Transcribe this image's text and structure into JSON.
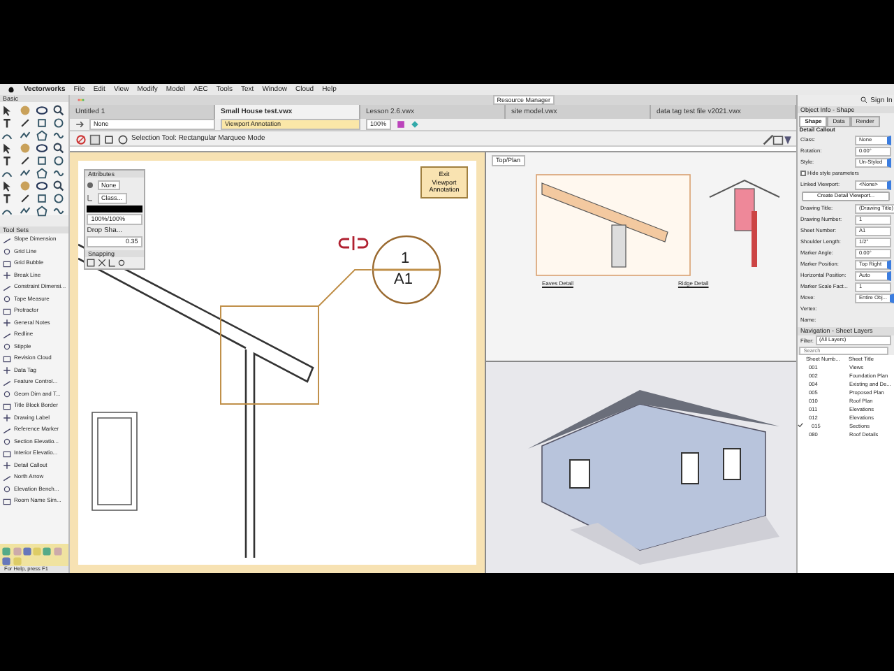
{
  "menu_bar": {
    "items": [
      "Vectorworks",
      "File",
      "Edit",
      "View",
      "Modify",
      "Model",
      "AEC",
      "Tools",
      "Text",
      "Window",
      "Cloud",
      "Help"
    ]
  },
  "title_bar": {
    "resource_manager": "Resource Manager",
    "sign_in": "Sign In"
  },
  "tabs": [
    {
      "label": "Untitled 1",
      "selected": false
    },
    {
      "label": "Small House test.vwx",
      "selected": true
    },
    {
      "label": "Lesson 2.6.vwx",
      "selected": false
    },
    {
      "label": "site model.vwx",
      "selected": false
    },
    {
      "label": "data tag test file v2021.vwx",
      "selected": false
    }
  ],
  "view_bar": {
    "class": "None",
    "layer": "Viewport Annotation",
    "zoom": "100%"
  },
  "mode_bar": {
    "hint": "Selection Tool: Rectangular Marquee Mode"
  },
  "basic_palette": {
    "title": "Basic"
  },
  "tool_sets": {
    "title": "Tool Sets",
    "items": [
      "Slope Dimension",
      "Grid Line",
      "Grid Bubble",
      "Break Line",
      "Constraint Dimensi...",
      "Tape Measure",
      "Protractor",
      "General Notes",
      "Redline",
      "Stipple",
      "Revision Cloud",
      "Data Tag",
      "Feature Control...",
      "Geom Dim and T...",
      "Title Block Border",
      "Drawing Label",
      "Reference Marker",
      "Section Elevatio...",
      "Interior Elevatio...",
      "Detail Callout",
      "North Arrow",
      "Elevation Bench...",
      "Room Name Sim..."
    ]
  },
  "attributes": {
    "title": "Attributes",
    "fill": "None",
    "pen": "Class...",
    "opacity": "100%/100%",
    "drop_shadow": "Drop Sha...",
    "line_weight": "0.35"
  },
  "snapping": {
    "title": "Snapping"
  },
  "canvas": {
    "exit_button": "Exit Viewport Annotation",
    "callout_number": "1",
    "callout_sheet": "A1"
  },
  "plan_view": {
    "tab": "Top/Plan",
    "details": [
      "Eaves Detail",
      "Ridge Detail"
    ]
  },
  "object_info": {
    "title": "Object Info - Shape",
    "tabs": [
      {
        "label": "Shape",
        "selected": true
      },
      {
        "label": "Data",
        "selected": false
      },
      {
        "label": "Render",
        "selected": false
      }
    ],
    "object_type": "Detail Callout",
    "fields": [
      {
        "kind": "select",
        "label": "Class:",
        "value": "None"
      },
      {
        "kind": "text",
        "label": "Rotation:",
        "value": "0.00°"
      },
      {
        "kind": "select",
        "label": "Style:",
        "value": "Un-Styled"
      },
      {
        "kind": "checkbox",
        "label": "Hide style parameters",
        "checked": false
      },
      {
        "kind": "select",
        "label": "Linked Viewport:",
        "value": "<None>"
      },
      {
        "kind": "button",
        "label": "Create Detail Viewport..."
      },
      {
        "kind": "text",
        "label": "Drawing Title:",
        "value": "(Drawing Title)"
      },
      {
        "kind": "text",
        "label": "Drawing Number:",
        "value": "1"
      },
      {
        "kind": "text",
        "label": "Sheet Number:",
        "value": "A1"
      },
      {
        "kind": "text",
        "label": "Shoulder Length:",
        "value": "1/2\""
      },
      {
        "kind": "text",
        "label": "Marker Angle:",
        "value": "0.00°"
      },
      {
        "kind": "select",
        "label": "Marker Position:",
        "value": "Top Right"
      },
      {
        "kind": "select",
        "label": "Horizontal Position:",
        "value": "Auto"
      },
      {
        "kind": "text",
        "label": "Marker Scale Fact...",
        "value": "1"
      },
      {
        "kind": "select",
        "label": "Move:",
        "value": "Entire Obj..."
      },
      {
        "kind": "label",
        "label": "Vertex:"
      },
      {
        "kind": "label",
        "label": "Name:"
      }
    ]
  },
  "navigation": {
    "title": "Navigation - Sheet Layers",
    "filter_label": "Filter:",
    "filter": "(All Layers)",
    "search_placeholder": "Search",
    "columns": [
      "Sheet Numb...",
      "Sheet Title"
    ],
    "rows": [
      {
        "number": "001",
        "title": "Views",
        "active": false
      },
      {
        "number": "002",
        "title": "Foundation Plan",
        "active": false
      },
      {
        "number": "004",
        "title": "Existing and De...",
        "active": false
      },
      {
        "number": "005",
        "title": "Proposed Plan",
        "active": false
      },
      {
        "number": "010",
        "title": "Roof Plan",
        "active": false
      },
      {
        "number": "011",
        "title": "Elevations",
        "active": false
      },
      {
        "number": "012",
        "title": "Elevations",
        "active": false
      },
      {
        "number": "015",
        "title": "Sections",
        "active": true
      },
      {
        "number": "080",
        "title": "Roof Details",
        "active": false
      }
    ]
  },
  "status_bar": {
    "text": "For Help, press F1"
  }
}
